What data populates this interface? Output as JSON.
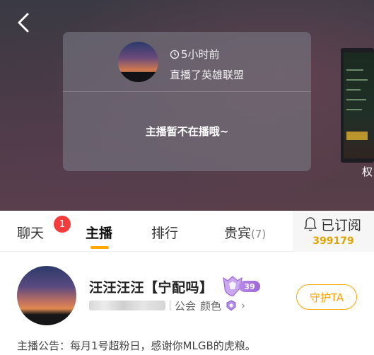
{
  "video": {
    "card": {
      "time_ago": "5小时前",
      "streamed_game": "直播了英雄联盟",
      "offline_message": "主播暂不在播哦~"
    },
    "side_label": "权"
  },
  "tabs": [
    {
      "label": "聊天",
      "badge": "1"
    },
    {
      "label": "主播",
      "active": true
    },
    {
      "label": "排行"
    },
    {
      "label": "贵宾",
      "count": "(7)"
    }
  ],
  "subscribe": {
    "label": "已订阅",
    "count": "399179"
  },
  "anchor": {
    "name": "汪汪汪汪【宁配吗】",
    "level": "39",
    "guild": "公会",
    "color_label": "颜色",
    "guard_button": "守护TA",
    "notice": "主播公告：每月1号超粉日，感谢你MLGB的虎粮。"
  },
  "colors": {
    "accent": "#ffa800",
    "badge_red": "#f43c3c",
    "level_purple": "#9d64d8"
  },
  "icons": [
    "back-arrow-icon",
    "clock-icon",
    "bell-icon",
    "level-shield-icon",
    "color-icon",
    "chevron-right-icon"
  ]
}
